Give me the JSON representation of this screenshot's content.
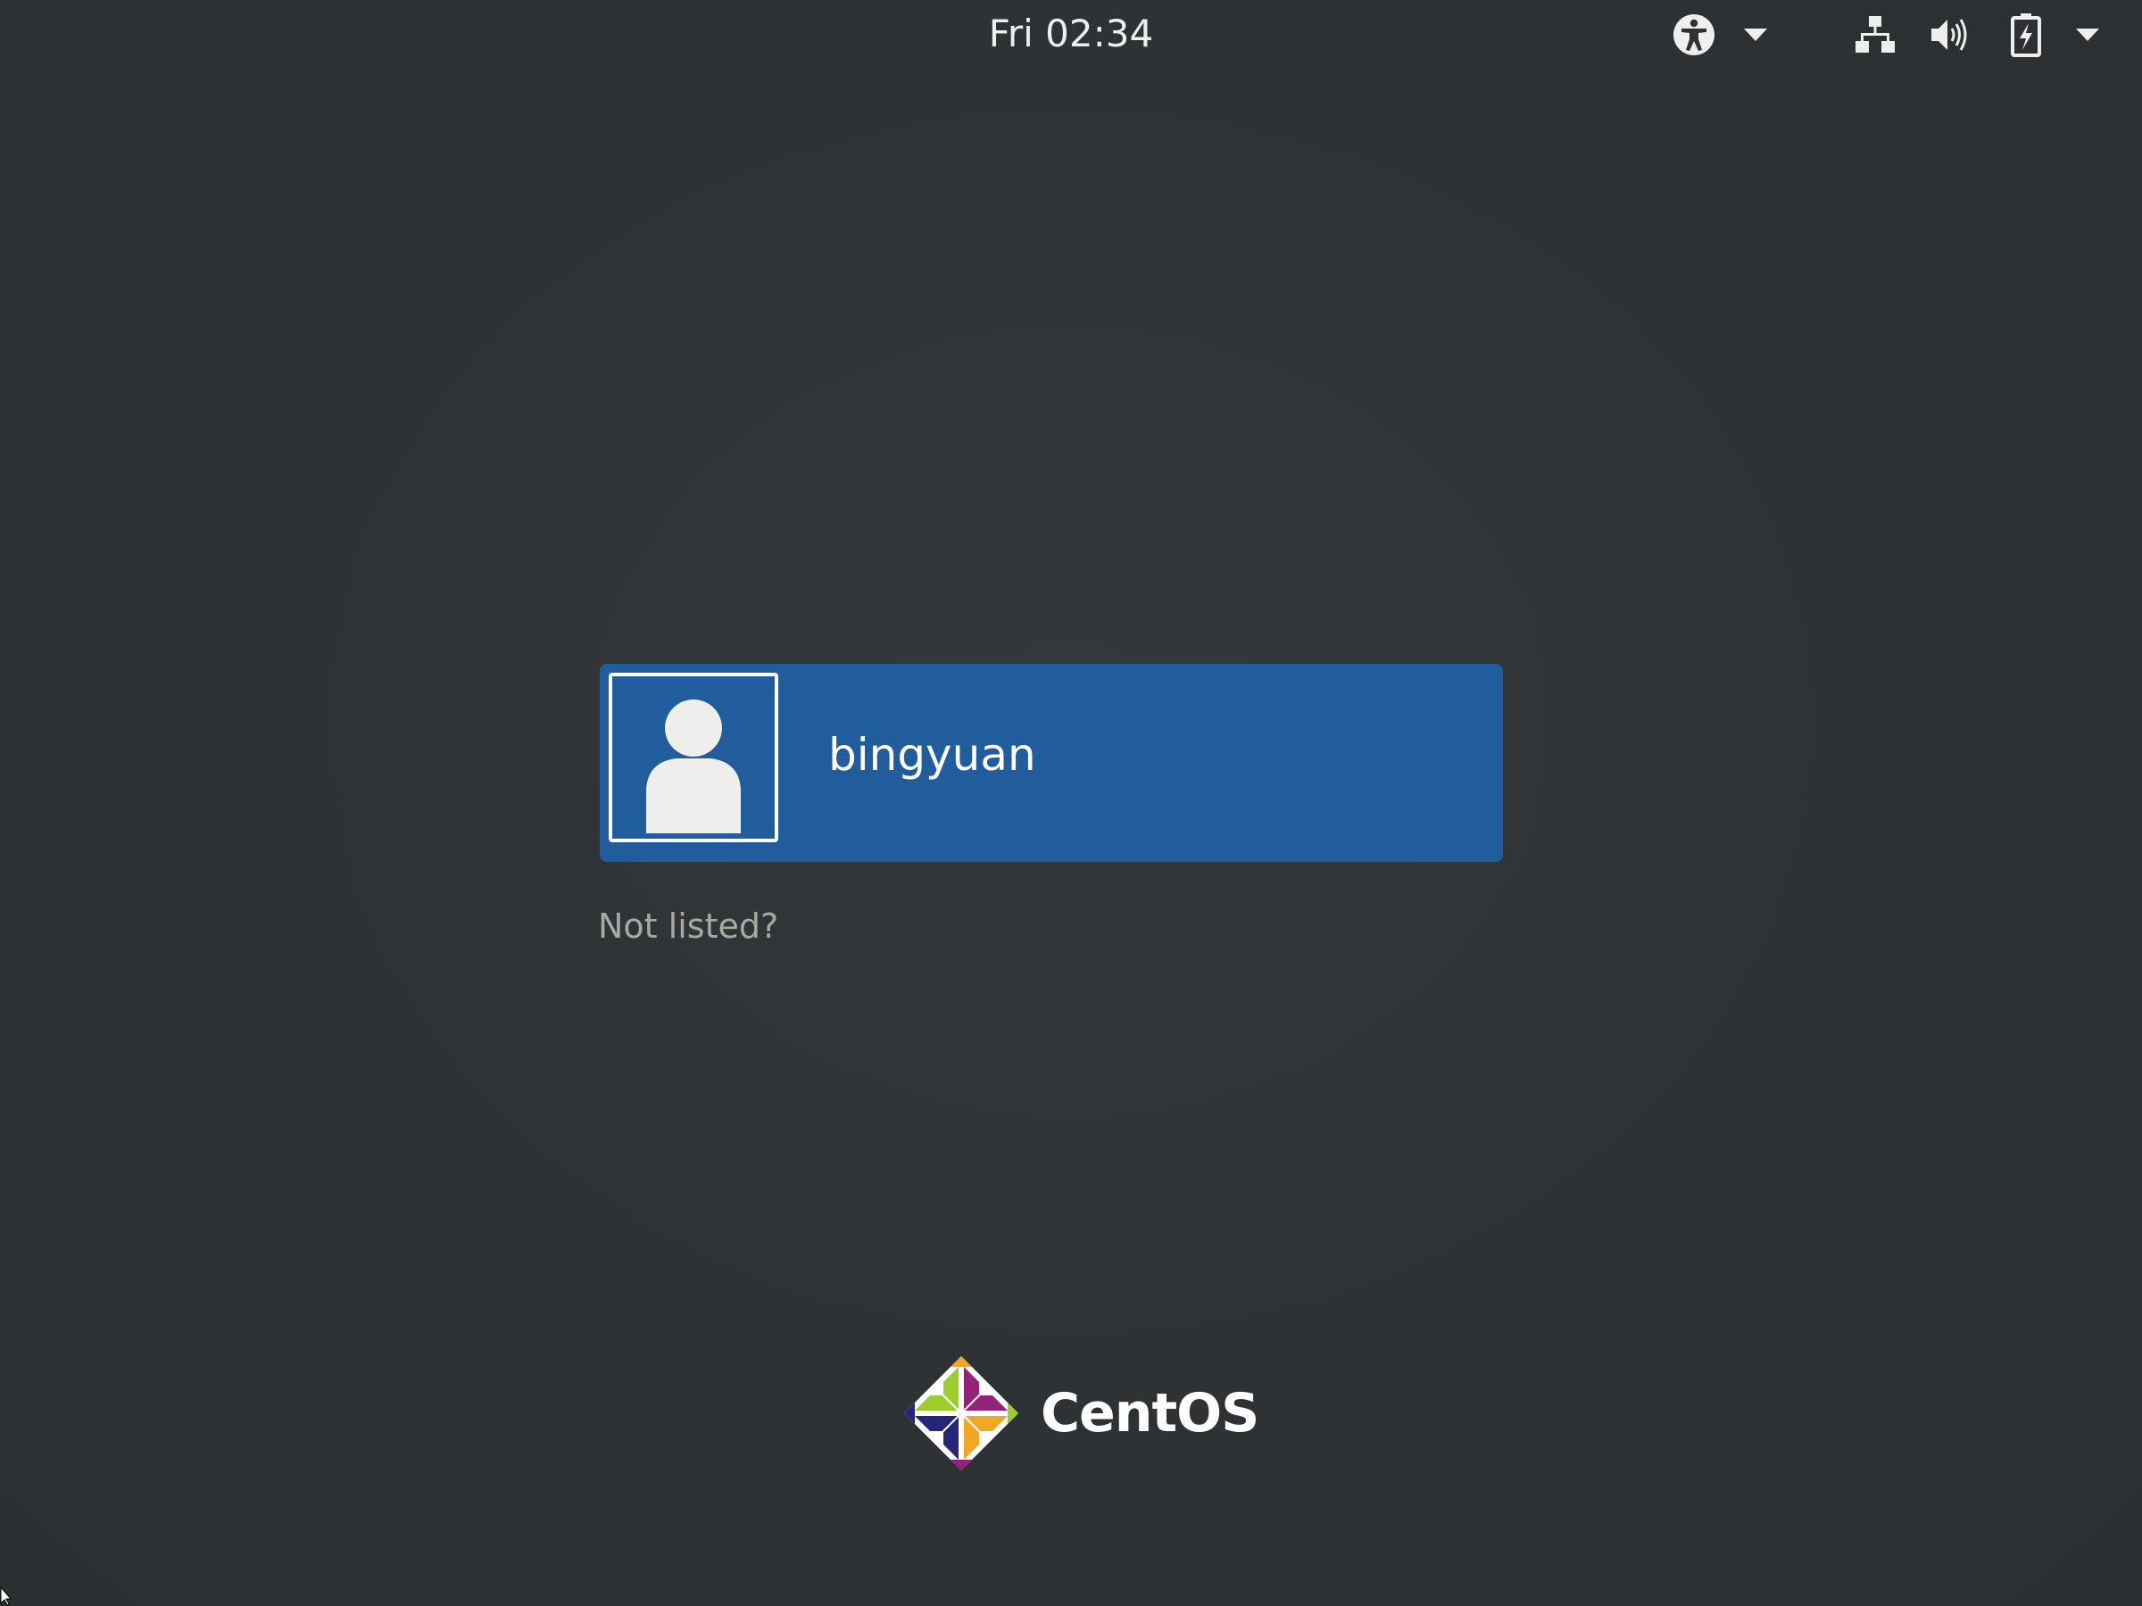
{
  "panel": {
    "clock": "Fri 02:34",
    "icons": {
      "accessibility": "accessibility-icon",
      "accessibility_menu": "chevron-down-icon",
      "network": "network-wired-icon",
      "volume": "volume-icon",
      "battery": "battery-charging-icon",
      "system_menu": "chevron-down-icon"
    }
  },
  "login": {
    "users": [
      {
        "name": "bingyuan",
        "avatar": "user-avatar-icon"
      }
    ],
    "not_listed_label": "Not listed?"
  },
  "branding": {
    "logo_text": "CentOS"
  },
  "colors": {
    "background": "#2e3234",
    "selected_user": "#215d9c",
    "text": "#ffffff",
    "muted_text": "#a9a9a4"
  }
}
